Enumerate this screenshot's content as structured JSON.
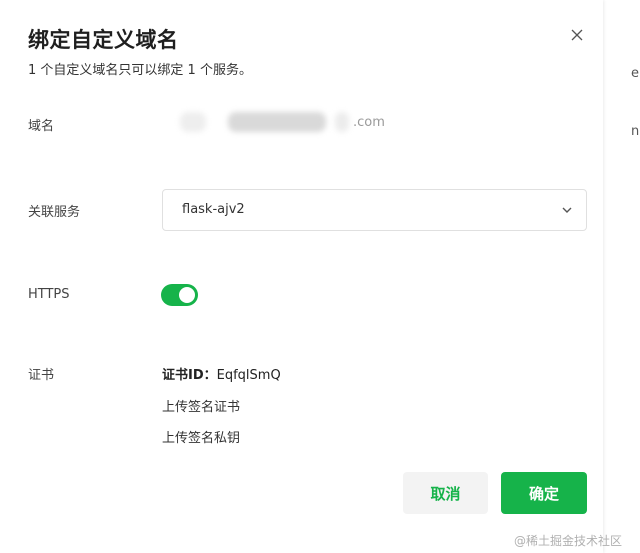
{
  "backdrop": {
    "fragment_1": "er",
    "fragment_2": "no"
  },
  "dialog": {
    "title": "绑定自定义域名",
    "subtitle": "1 个自定义域名只可以绑定 1 个服务。",
    "close_icon": "close-icon"
  },
  "form": {
    "domain_label": "域名",
    "domain_suffix": ".com",
    "service_label": "关联服务",
    "service_value": "flask-ajv2",
    "https_label": "HTTPS",
    "https_enabled": true,
    "cert_label": "证书",
    "cert_id_key": "证书ID：",
    "cert_id_value": "EqfqlSmQ",
    "upload_cert": "上传签名证书",
    "upload_key": "上传签名私钥"
  },
  "buttons": {
    "cancel": "取消",
    "confirm": "确定"
  },
  "watermark": "@稀土掘金技术社区",
  "colors": {
    "accent": "#16b34a",
    "title": "#1f1f1f",
    "label": "#444444",
    "muted": "#9a9a9a"
  }
}
